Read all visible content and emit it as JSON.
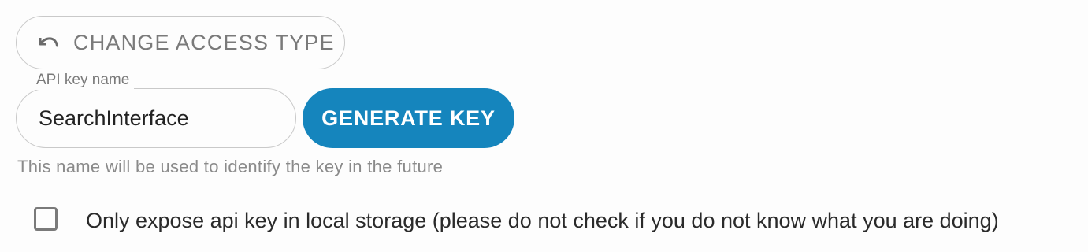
{
  "change_access": {
    "label": "Change access type",
    "icon": "undo-icon"
  },
  "api_key_field": {
    "label": "API key name",
    "value": "SearchInterface",
    "helper_text": "This name will be used to identify the key in the future"
  },
  "generate_button": {
    "label": "Generate key"
  },
  "local_storage_option": {
    "label": "Only expose api key in local storage (please do not check if you do not know what you are doing)",
    "checked": false
  },
  "colors": {
    "accent": "#1585bd",
    "border": "#c9c9c9",
    "muted_text": "#7a7a7a",
    "background": "#fdfdfd"
  }
}
